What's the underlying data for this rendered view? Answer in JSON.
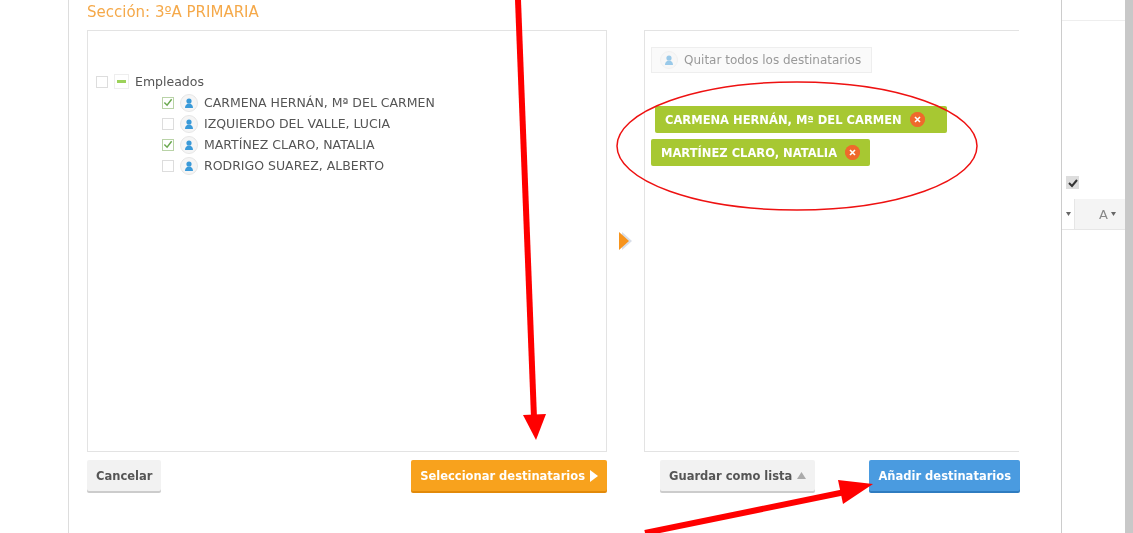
{
  "section_title": "Sección: 3ºA PRIMARIA",
  "tree": {
    "label": "Empleados",
    "checked": false,
    "expanded": true,
    "children": [
      {
        "label": "CARMENA HERNÁN, Mª DEL CARMEN",
        "checked": true
      },
      {
        "label": "IZQUIERDO DEL VALLE, LUCIA",
        "checked": false
      },
      {
        "label": "MARTÍNEZ CLARO, NATALIA",
        "checked": true
      },
      {
        "label": "RODRIGO SUAREZ, ALBERTO",
        "checked": false
      }
    ]
  },
  "remove_all_button": "Quitar todos los destinatarios",
  "recipients": [
    {
      "label": "CARMENA HERNÁN, Mª DEL CARMEN"
    },
    {
      "label": "MARTÍNEZ CLARO, NATALIA"
    }
  ],
  "buttons": {
    "cancel": "Cancelar",
    "select": "Seleccionar destinatarios",
    "save_list": "Guardar como lista",
    "add": "Añadir destinatarios"
  },
  "background_window": {
    "checkbox_checked": true,
    "toolbar_label": "A"
  }
}
